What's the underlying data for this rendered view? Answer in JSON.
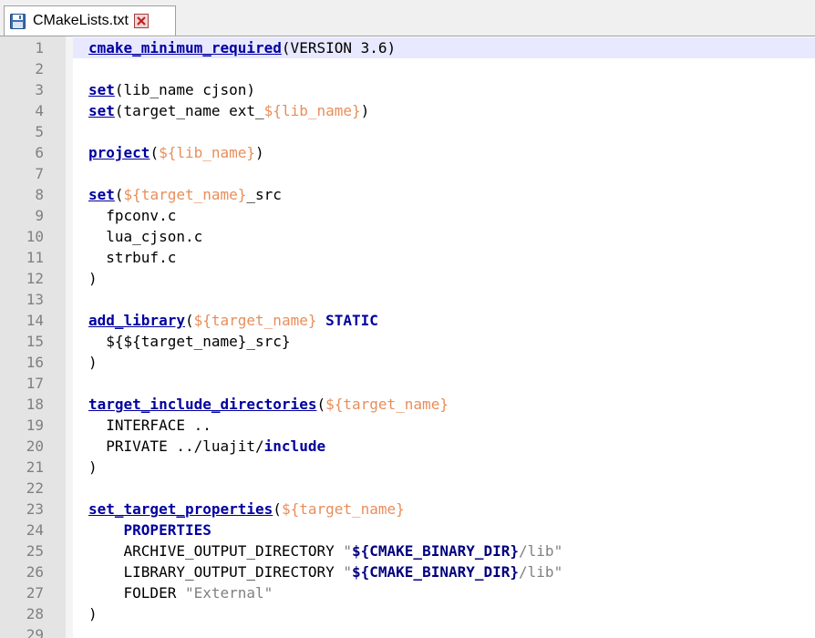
{
  "tab": {
    "title": "CMakeLists.txt",
    "save_icon": "floppy-disk-icon",
    "close_icon": "close-x-icon"
  },
  "colors": {
    "keyword": "#0000a0",
    "variable": "#e88e5a",
    "string": "#808080",
    "current_line": "#e8e8ff",
    "gutter": "#e4e4e4"
  },
  "editor": {
    "current_line": 1,
    "lines": [
      {
        "n": "1",
        "tokens": [
          {
            "t": "cmake_minimum_required",
            "c": "kw"
          },
          {
            "t": "(VERSION 3.6)",
            "c": "pl"
          }
        ]
      },
      {
        "n": "2",
        "tokens": []
      },
      {
        "n": "3",
        "tokens": [
          {
            "t": "set",
            "c": "kw"
          },
          {
            "t": "(lib_name cjson)",
            "c": "pl"
          }
        ]
      },
      {
        "n": "4",
        "tokens": [
          {
            "t": "set",
            "c": "kw"
          },
          {
            "t": "(target_name ext_",
            "c": "pl"
          },
          {
            "t": "${lib_name}",
            "c": "var"
          },
          {
            "t": ")",
            "c": "pl"
          }
        ]
      },
      {
        "n": "5",
        "tokens": []
      },
      {
        "n": "6",
        "tokens": [
          {
            "t": "project",
            "c": "kw"
          },
          {
            "t": "(",
            "c": "pl"
          },
          {
            "t": "${lib_name}",
            "c": "var"
          },
          {
            "t": ")",
            "c": "pl"
          }
        ]
      },
      {
        "n": "7",
        "tokens": []
      },
      {
        "n": "8",
        "tokens": [
          {
            "t": "set",
            "c": "kw"
          },
          {
            "t": "(",
            "c": "pl"
          },
          {
            "t": "${target_name}",
            "c": "var"
          },
          {
            "t": "_src",
            "c": "pl"
          }
        ]
      },
      {
        "n": "9",
        "tokens": [
          {
            "t": "  fpconv.c",
            "c": "pl"
          }
        ]
      },
      {
        "n": "10",
        "tokens": [
          {
            "t": "  lua_cjson.c",
            "c": "pl"
          }
        ]
      },
      {
        "n": "11",
        "tokens": [
          {
            "t": "  strbuf.c",
            "c": "pl"
          }
        ]
      },
      {
        "n": "12",
        "tokens": [
          {
            "t": ")",
            "c": "pl"
          }
        ]
      },
      {
        "n": "13",
        "tokens": []
      },
      {
        "n": "14",
        "tokens": [
          {
            "t": "add_library",
            "c": "kw"
          },
          {
            "t": "(",
            "c": "pl"
          },
          {
            "t": "${target_name}",
            "c": "var"
          },
          {
            "t": " ",
            "c": "pl"
          },
          {
            "t": "STATIC",
            "c": "kwb"
          }
        ]
      },
      {
        "n": "15",
        "tokens": [
          {
            "t": "  ${${target_name}_src}",
            "c": "pl"
          }
        ]
      },
      {
        "n": "16",
        "tokens": [
          {
            "t": ")",
            "c": "pl"
          }
        ]
      },
      {
        "n": "17",
        "tokens": []
      },
      {
        "n": "18",
        "tokens": [
          {
            "t": "target_include_directories",
            "c": "kw"
          },
          {
            "t": "(",
            "c": "pl"
          },
          {
            "t": "${target_name}",
            "c": "var"
          }
        ]
      },
      {
        "n": "19",
        "tokens": [
          {
            "t": "  INTERFACE ..",
            "c": "pl"
          }
        ]
      },
      {
        "n": "20",
        "tokens": [
          {
            "t": "  PRIVATE ../luajit/",
            "c": "pl"
          },
          {
            "t": "include",
            "c": "kwb"
          }
        ]
      },
      {
        "n": "21",
        "tokens": [
          {
            "t": ")",
            "c": "pl"
          }
        ]
      },
      {
        "n": "22",
        "tokens": []
      },
      {
        "n": "23",
        "tokens": [
          {
            "t": "set_target_properties",
            "c": "kw"
          },
          {
            "t": "(",
            "c": "pl"
          },
          {
            "t": "${target_name}",
            "c": "var"
          }
        ]
      },
      {
        "n": "24",
        "tokens": [
          {
            "t": "    ",
            "c": "pl"
          },
          {
            "t": "PROPERTIES",
            "c": "kwb"
          }
        ]
      },
      {
        "n": "25",
        "tokens": [
          {
            "t": "    ARCHIVE_OUTPUT_DIRECTORY ",
            "c": "pl"
          },
          {
            "t": "\"",
            "c": "str"
          },
          {
            "t": "${CMAKE_BINARY_DIR}",
            "c": "strvar"
          },
          {
            "t": "/lib\"",
            "c": "str"
          }
        ]
      },
      {
        "n": "26",
        "tokens": [
          {
            "t": "    LIBRARY_OUTPUT_DIRECTORY ",
            "c": "pl"
          },
          {
            "t": "\"",
            "c": "str"
          },
          {
            "t": "${CMAKE_BINARY_DIR}",
            "c": "strvar"
          },
          {
            "t": "/lib\"",
            "c": "str"
          }
        ]
      },
      {
        "n": "27",
        "tokens": [
          {
            "t": "    FOLDER ",
            "c": "pl"
          },
          {
            "t": "\"External\"",
            "c": "str"
          }
        ]
      },
      {
        "n": "28",
        "tokens": [
          {
            "t": ")",
            "c": "pl"
          }
        ]
      },
      {
        "n": "29",
        "tokens": []
      }
    ]
  }
}
